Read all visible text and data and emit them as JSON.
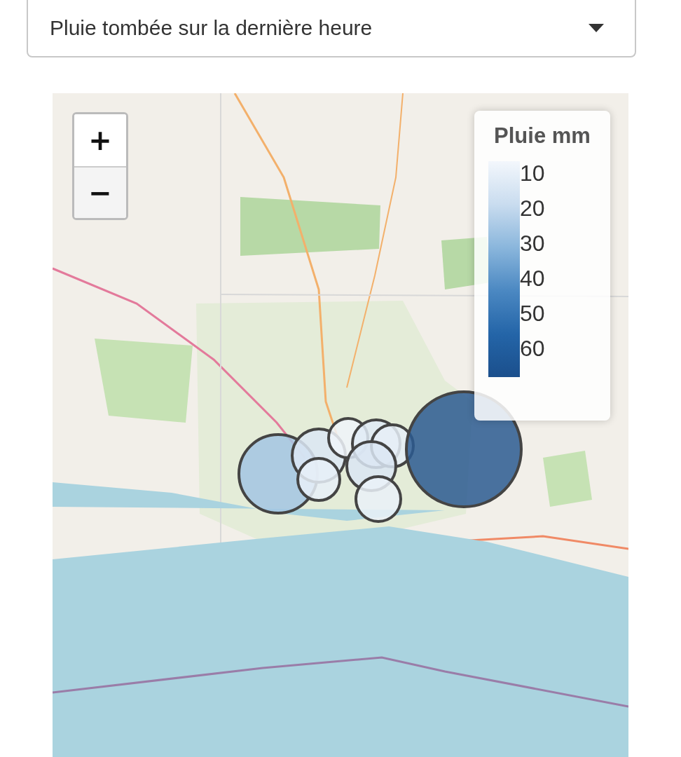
{
  "dropdown": {
    "value": "Pluie tombée sur la dernière heure"
  },
  "map": {
    "zoom_in": "+",
    "zoom_out": "−",
    "legend": {
      "title": "Pluie mm",
      "ticks": [
        "10",
        "20",
        "30",
        "40",
        "50",
        "60"
      ]
    },
    "markers": [
      {
        "color": "#a3c6e3"
      },
      {
        "color": "#dce8f5"
      },
      {
        "color": "#e8f0f8"
      },
      {
        "color": "#f0f4fa"
      },
      {
        "color": "#e0ebf6"
      },
      {
        "color": "#e6eef7"
      },
      {
        "color": "#dae6f3"
      },
      {
        "color": "#eaf1f8"
      },
      {
        "color": "#2b5b91"
      }
    ]
  }
}
